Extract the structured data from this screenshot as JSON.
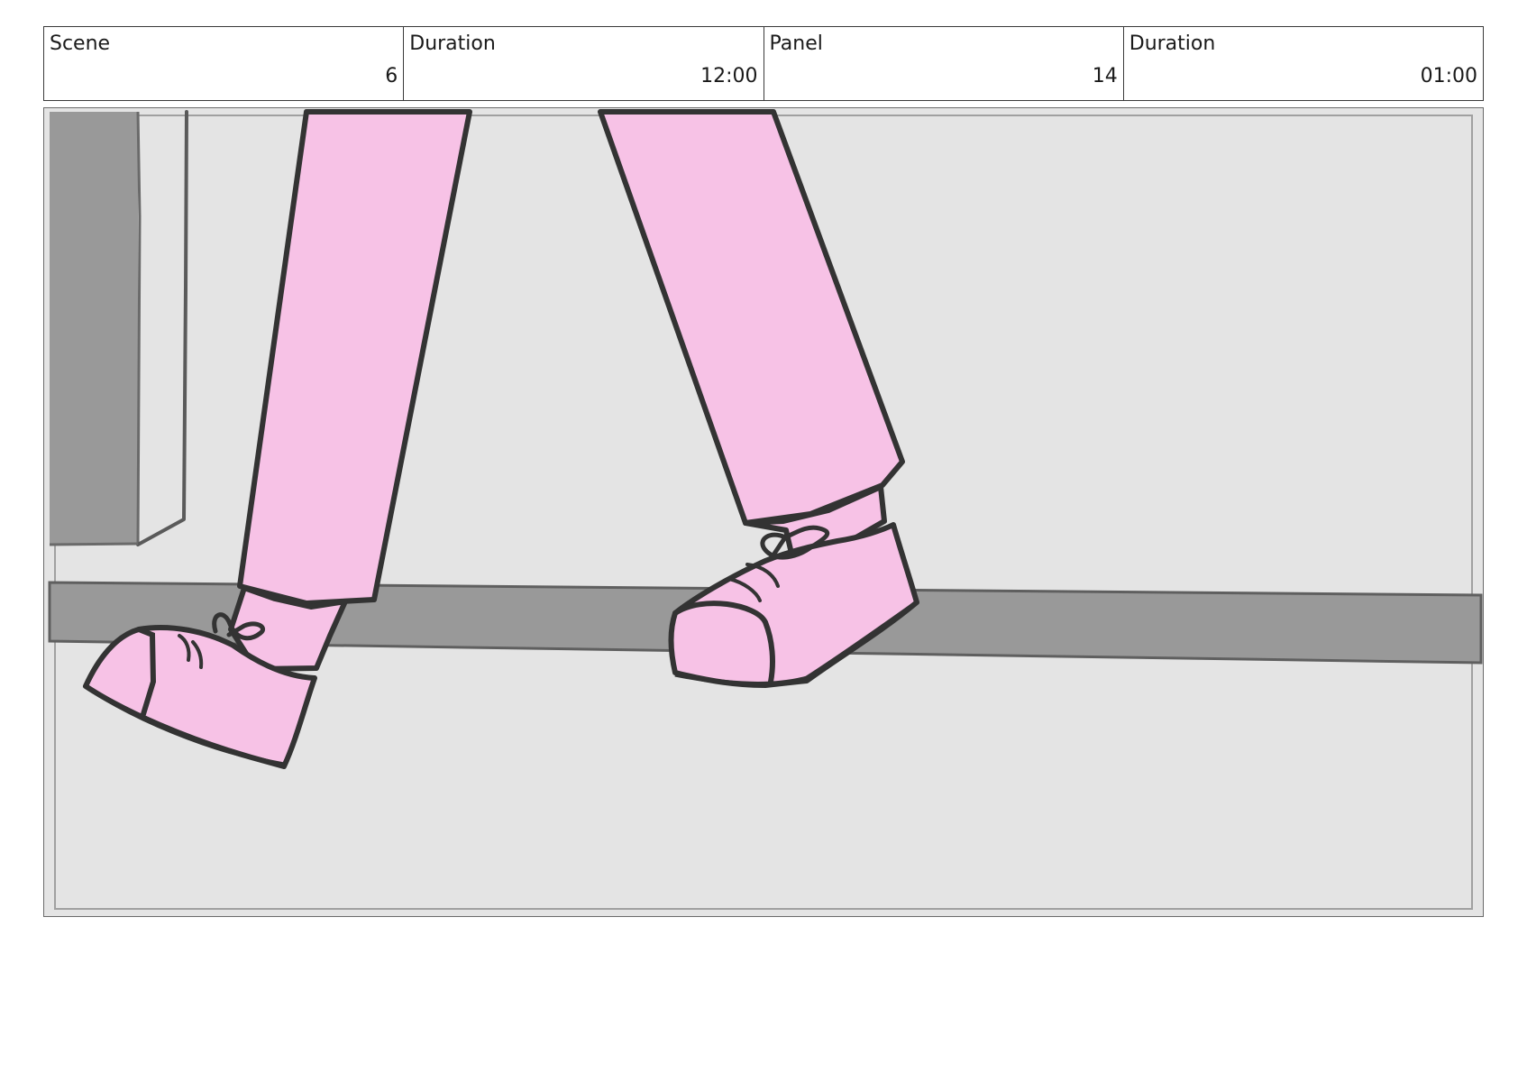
{
  "header": {
    "scene": {
      "label": "Scene",
      "value": "6"
    },
    "scene_duration": {
      "label": "Duration",
      "value": "12:00"
    },
    "panel": {
      "label": "Panel",
      "value": "14"
    },
    "panel_duration": {
      "label": "Duration",
      "value": "01:00"
    }
  },
  "panel_image": {
    "subject": "walking-legs-sketch",
    "colors": {
      "background": "#e4e4e4",
      "pants": "#f7c2e6",
      "outline": "#333333",
      "baseboard": "#999999",
      "door": "#999999"
    }
  }
}
